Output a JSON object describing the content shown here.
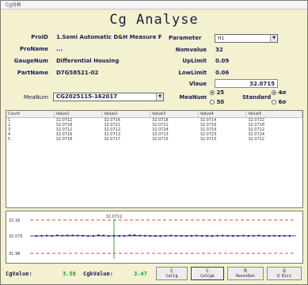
{
  "window": {
    "title": "Cg分析"
  },
  "header": {
    "title": "Cg Analyse"
  },
  "left": {
    "proid_label": "ProID",
    "proid_value": "1.Semi Automatic D&H  Measure F",
    "proname_label": "ProName",
    "proname_value": "...",
    "gaugenum_label": "GaugeNum",
    "gaugenum_value": "Differential Housing",
    "partname_label": "PartName",
    "partname_value": "D7G58521-02",
    "meanum_label": "MeaNum",
    "meanum_value": "CG2025115-162017"
  },
  "right": {
    "parameter_label": "Parameter",
    "parameter_value": "H1",
    "nomvalue_label": "Nomvalue",
    "nomvalue_value": "32",
    "uplimit_label": "UpLimit",
    "uplimit_value": "0.09",
    "lowlimit_label": "LowLimit",
    "lowlimit_value": "0.06",
    "vlaue_label": "Vlaue",
    "vlaue_value": "32.0715",
    "meanum_label": "MeaNum",
    "meanum_opt1": "25",
    "meanum_opt2": "50",
    "standard_label": "Standard",
    "standard_opt1": "4σ",
    "standard_opt2": "6σ"
  },
  "table": {
    "headers": [
      "Count",
      "Value1",
      "Value2",
      "Value3",
      "Value4",
      "Value5"
    ],
    "rows": [
      [
        "1",
        "32.0712",
        "32.0716",
        "32.0718",
        "32.0714",
        "32.0722"
      ],
      [
        "2",
        "32.0718",
        "32.0721",
        "32.0721",
        "32.0719",
        "32.0718"
      ],
      [
        "3",
        "32.0712",
        "32.0712",
        "32.0724",
        "32.0719",
        "32.0712"
      ],
      [
        "4",
        "32.0716",
        "32.0713",
        "32.0713",
        "32.0723",
        "32.0724"
      ],
      [
        "5",
        "32.0718",
        "32.0717",
        "32.0715",
        "32.0713",
        "32.0712"
      ]
    ]
  },
  "chart_data": {
    "type": "line",
    "top_annotation": "32.0712",
    "ytick_labels": [
      "32.16",
      "32.075",
      "31.98"
    ],
    "reference_lines": [
      32.16,
      32.075,
      31.98
    ],
    "ylim": [
      31.95,
      32.19
    ],
    "values": [
      32.0712,
      32.0716,
      32.0718,
      32.0714,
      32.0722,
      32.0718,
      32.0721,
      32.0721,
      32.0719,
      32.0718,
      32.0712,
      32.0712,
      32.0724,
      32.0719,
      32.0712,
      32.0716,
      32.0713,
      32.0713,
      32.0723,
      32.0724,
      32.0718,
      32.0717,
      32.0715,
      32.0713,
      32.0712,
      32.0716,
      32.0719,
      32.0714,
      32.0717,
      32.0713,
      32.0716,
      32.0718,
      32.0715,
      32.0714,
      32.0712,
      32.0717,
      32.0719,
      32.0716,
      32.0713,
      32.0715,
      32.0718,
      32.0714,
      32.0716,
      32.0719,
      32.0713,
      32.0715,
      32.0717,
      32.0714,
      32.0716,
      32.0715
    ],
    "highlight_index": 15
  },
  "footer": {
    "cg_label": "CgValue:",
    "cg_value": "3.58",
    "cgk_label": "CgkValue:",
    "cgk_value": "3.47",
    "buttons": [
      {
        "key": "C",
        "label": "CalCg"
      },
      {
        "key": "C",
        "label": "CalCgk"
      },
      {
        "key": "R",
        "label": "ResetDat"
      },
      {
        "key": "Q",
        "label": "Q Exit"
      }
    ]
  },
  "colors": {
    "background": "#f3f1cf",
    "label": "#1c1c52",
    "cg_value": "#1a9a3a",
    "limit_line": "#e04545",
    "mid_line": "#3a46c8",
    "highlight": "#2da84a"
  }
}
